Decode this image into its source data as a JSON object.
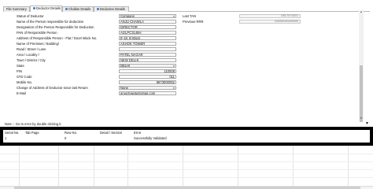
{
  "tabs": [
    {
      "label": "File Summary"
    },
    {
      "label": "Deductor Details"
    },
    {
      "label": "Challan Details"
    },
    {
      "label": "Deductee Details"
    }
  ],
  "form": {
    "status": {
      "label": "Status of Deductor",
      "value": "Company"
    },
    "responsible_name": {
      "label": "Name of the Person responsible for deduction",
      "value": "ANJU CHAWLA"
    },
    "designation": {
      "label": "Designation of the Person Responsible for Deduction",
      "value": "DIRECTOR"
    },
    "pan_responsible": {
      "label": "PAN of Responsible Person",
      "value": "AGLPC3149H"
    },
    "address": {
      "label": "Address of Responsible Person - Flat / Door/ Block No.",
      "value": "E-18, B Block ,"
    },
    "premises": {
      "label": "Name of Premises / Building/",
      "value": "ASHOK TOWER"
    },
    "road": {
      "label": "Road / Street / Lane",
      "value": ""
    },
    "area": {
      "label": "Area / Locality /",
      "value": "PATEL NAGAR"
    },
    "town": {
      "label": "Town / District / City",
      "value": "NEW DELHI"
    },
    "state": {
      "label": "State",
      "value": "DELHI"
    },
    "pin": {
      "label": "PIN",
      "value": "110008"
    },
    "std": {
      "label": "STD Code",
      "value": "011"
    },
    "mobile": {
      "label": "Mobile No.",
      "value": "9873000052"
    },
    "change_address": {
      "label": "Change of Address of Deductor since last Return",
      "value": "None"
    },
    "email": {
      "label": "E-Mail",
      "value": "anujchawla@gmail.com"
    }
  },
  "right": {
    "last_tan": {
      "label": "Last TAN",
      "value": "DELT07102G"
    },
    "previous_rrr": {
      "label": "Previous RRR",
      "value": "410000151000000"
    }
  },
  "note": "Note :- Go to error by double clicking it.",
  "errors": {
    "headers": [
      "Serial No.",
      "Tab Page",
      "Row No.",
      "Detail / Section",
      "Error"
    ],
    "rows": [
      [
        "1",
        "",
        "0",
        "",
        "Successfully Validated"
      ]
    ]
  },
  "icons": {
    "dropdown": "chevron-down-icon",
    "scroll_up": "arrow-up-icon",
    "scroll_down": "arrow-down-icon",
    "pin": "pin-icon"
  }
}
